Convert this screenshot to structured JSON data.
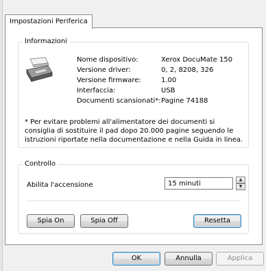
{
  "tab": {
    "label": "Impostazioni Periferica"
  },
  "info": {
    "legend": "Informazioni",
    "rows": [
      {
        "label": "Nome dispositivo:",
        "value": "Xerox DocuMate 150"
      },
      {
        "label": "Versione driver:",
        "value": "0, 2, 8208, 326"
      },
      {
        "label": "Versione firmware:",
        "value": "1.00"
      },
      {
        "label": "Interfaccia:",
        "value": "USB"
      },
      {
        "label": "Documenti scansionati*:",
        "value": "Pagine 74188"
      }
    ],
    "note": "* Per evitare problemi all'alimentatore dei documenti si consiglia di sostituire il pad dopo 20.000 pagine seguendo le istruzioni riportate nella documentazione e nella Guida in linea."
  },
  "control": {
    "legend": "Controllo",
    "power_label": "Abilita l'accensione",
    "power_value": "15 minuti",
    "spia_on": "Spia On",
    "spia_off": "Spia Off",
    "reset": "Resetta"
  },
  "footer": {
    "ok": "OK",
    "cancel": "Annulla",
    "apply": "Applica"
  }
}
